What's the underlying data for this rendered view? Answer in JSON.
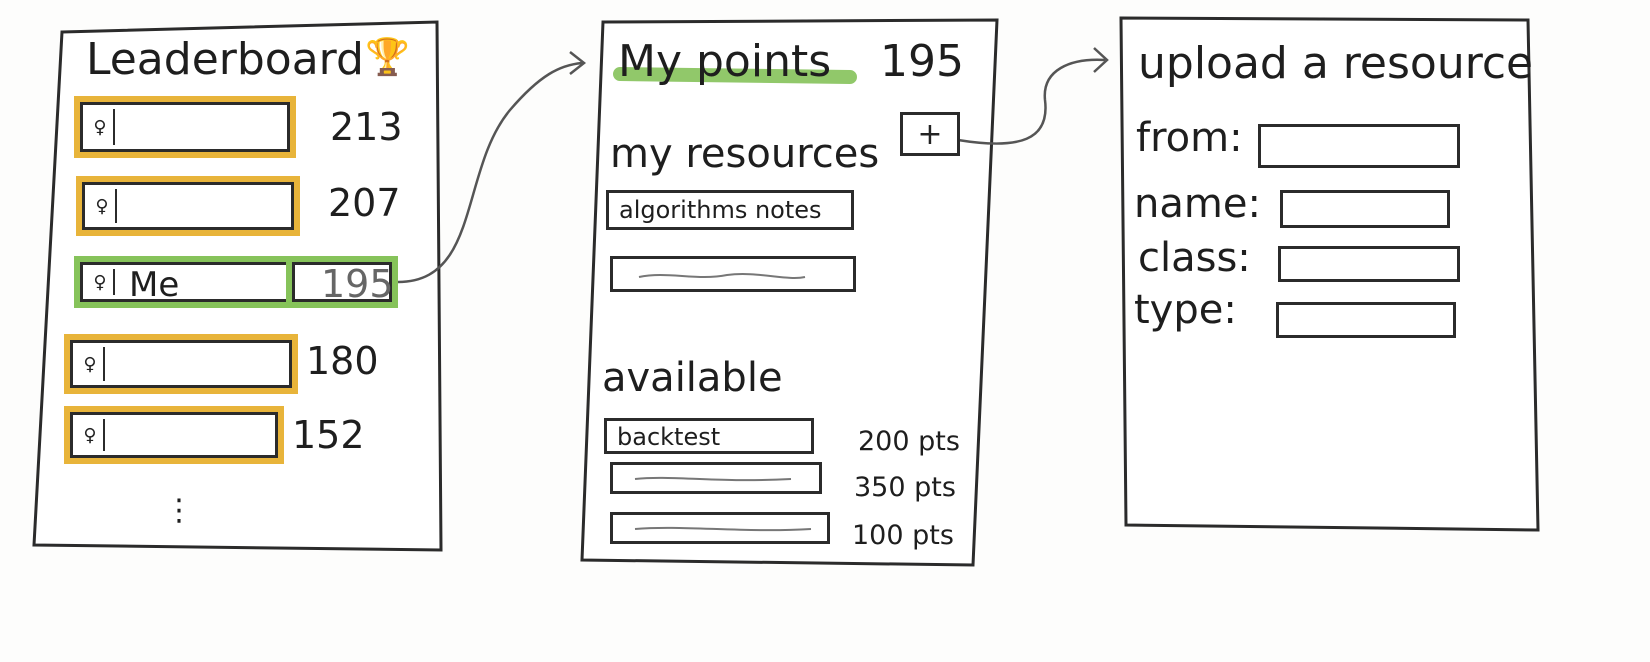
{
  "leaderboard": {
    "title": "Leaderboard",
    "trophy": "🏆",
    "rows": [
      {
        "name": "",
        "score": "213",
        "highlight": "#e8b43a"
      },
      {
        "name": "",
        "score": "207",
        "highlight": "#e8b43a"
      },
      {
        "name": "Me",
        "score": "195",
        "highlight": "#86c35a"
      },
      {
        "name": "",
        "score": "180",
        "highlight": "#e8b43a"
      },
      {
        "name": "",
        "score": "152",
        "highlight": "#e8b43a"
      }
    ],
    "more": "⋮"
  },
  "points_screen": {
    "title": "My points",
    "points": "195",
    "my_resources_label": "my resources",
    "add_button": "+",
    "resources": [
      "algorithms notes",
      ""
    ],
    "available_label": "available",
    "available_items": [
      {
        "name": "backtest",
        "price": "200 pts"
      },
      {
        "name": "",
        "price": "350 pts"
      },
      {
        "name": "",
        "price": "100 pts"
      }
    ]
  },
  "upload_screen": {
    "title": "upload a resource",
    "fields": [
      {
        "label": "from:",
        "value": ""
      },
      {
        "label": "name:",
        "value": ""
      },
      {
        "label": "class:",
        "value": ""
      },
      {
        "label": "type:",
        "value": ""
      }
    ]
  },
  "colors": {
    "gold_highlight": "#e8b43a",
    "green_highlight": "#86c35a",
    "ink": "#2b2b2b"
  },
  "icons": {
    "row_avatar": "person-icon",
    "trophy": "trophy-icon"
  }
}
